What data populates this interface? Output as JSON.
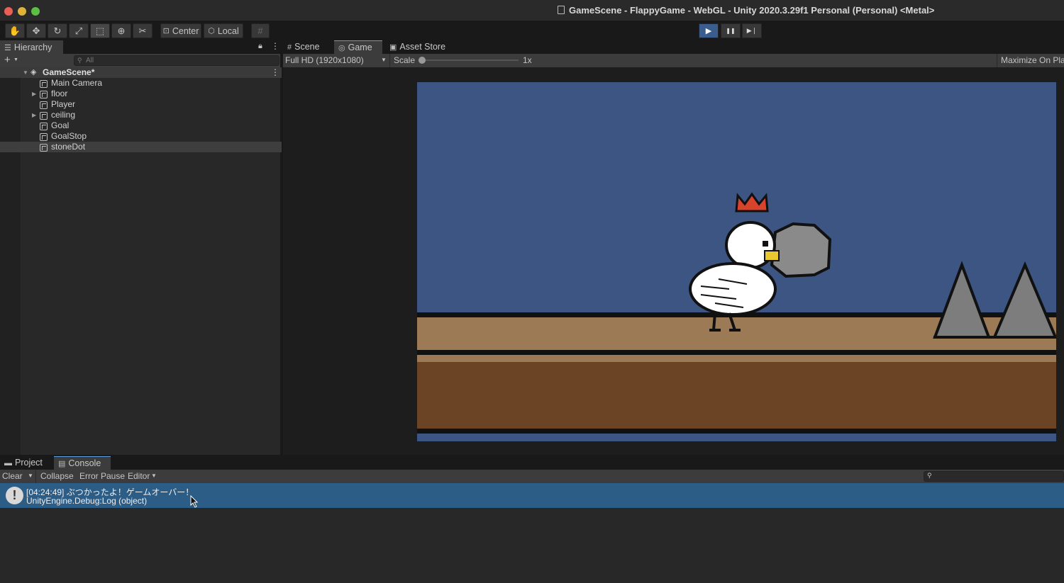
{
  "window": {
    "title": "GameScene - FlappyGame - WebGL - Unity 2020.3.29f1 Personal (Personal) <Metal>",
    "colors": {
      "close": "#ec5f57",
      "minimize": "#e0b23a",
      "maximize": "#5bbf45",
      "accent": "#3b5d8e"
    }
  },
  "toolbar": {
    "tools": [
      {
        "icon": "hand-tool-icon",
        "glyph": "✋"
      },
      {
        "icon": "move-tool-icon",
        "glyph": "✥"
      },
      {
        "icon": "rotate-tool-icon",
        "glyph": "↻"
      },
      {
        "icon": "scale-tool-icon",
        "glyph": "⤢"
      },
      {
        "icon": "rect-tool-icon",
        "glyph": "⬚"
      },
      {
        "icon": "transform-tool-icon",
        "glyph": "⊕"
      },
      {
        "icon": "custom-tool-icon",
        "glyph": "✂"
      }
    ],
    "pivot_label": "Center",
    "space_label": "Local",
    "play_glyph": "▶",
    "pause_glyph": "❚❚",
    "step_glyph": "▶❘"
  },
  "hierarchy": {
    "tab_label": "Hierarchy",
    "search_placeholder": "All",
    "scene_name": "GameScene*",
    "items": [
      {
        "label": "Main Camera",
        "expandable": false
      },
      {
        "label": "floor",
        "expandable": true
      },
      {
        "label": "Player",
        "expandable": false
      },
      {
        "label": "ceiling",
        "expandable": true
      },
      {
        "label": "Goal",
        "expandable": false
      },
      {
        "label": "GoalStop",
        "expandable": false
      },
      {
        "label": "stoneDot",
        "expandable": false,
        "selected": true
      }
    ]
  },
  "game_view": {
    "tabs": [
      "Scene",
      "Game",
      "Asset Store"
    ],
    "active_tab": "Game",
    "resolution": "Full HD (1920x1080)",
    "scale_label": "Scale",
    "scale_value": "1x",
    "maximize_label": "Maximize On Play",
    "colors": {
      "sky": "#3d5583",
      "ground_top": "#9d7a56",
      "ground_bottom": "#6a4424",
      "spike": "#7d7d7d"
    }
  },
  "console": {
    "tabs": [
      "Project",
      "Console"
    ],
    "active_tab": "Console",
    "clear_label": "Clear",
    "collapse_label": "Collapse",
    "error_pause_label": "Error Pause",
    "editor_label": "Editor",
    "log": {
      "line1": "[04:24:49] ぶつかったよ！ゲームオーバー！",
      "line2": "UnityEngine.Debug:Log (object)"
    }
  }
}
